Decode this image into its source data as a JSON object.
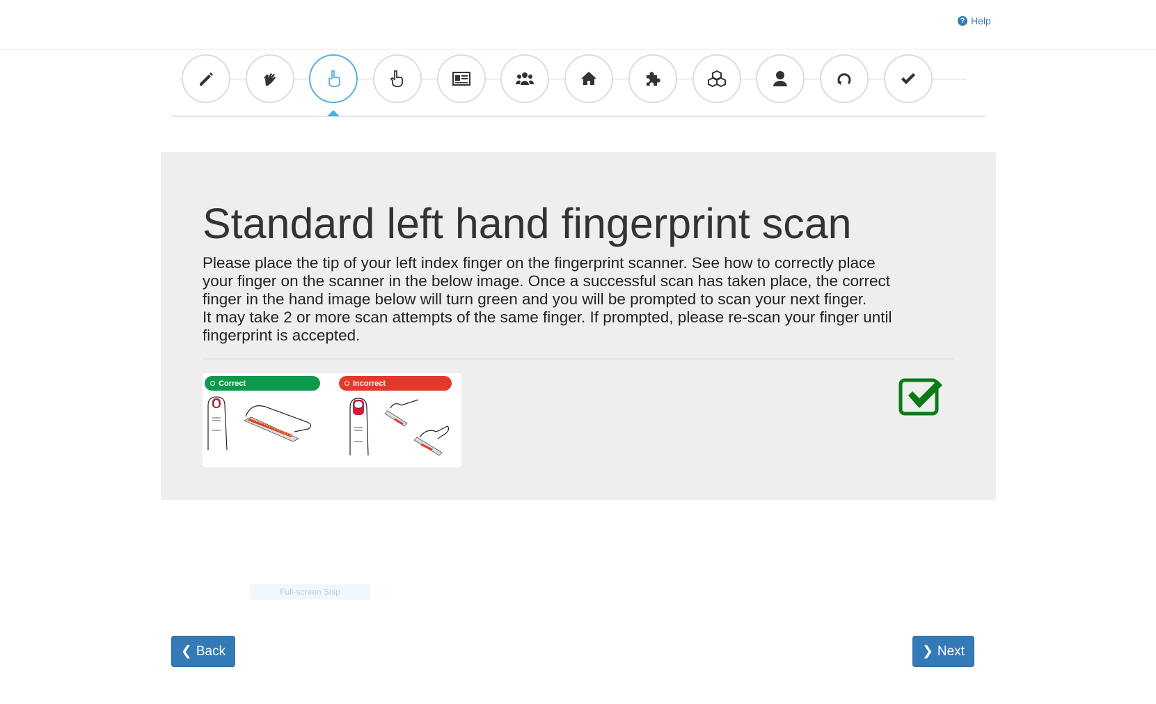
{
  "header": {
    "help_label": "Help",
    "help_icon": "question-circle-icon"
  },
  "stepper": {
    "active_index": 2,
    "steps": [
      {
        "icon": "pencil-icon"
      },
      {
        "icon": "sign-language-icon"
      },
      {
        "icon": "hand-pointer-icon"
      },
      {
        "icon": "hand-pointer-left-icon"
      },
      {
        "icon": "id-card-icon"
      },
      {
        "icon": "users-icon"
      },
      {
        "icon": "home-icon"
      },
      {
        "icon": "puzzle-icon"
      },
      {
        "icon": "cubes-icon"
      },
      {
        "icon": "user-icon"
      },
      {
        "icon": "reset-icon"
      },
      {
        "icon": "check-icon"
      }
    ]
  },
  "main": {
    "title": "Standard left hand fingerprint scan",
    "description_lines": [
      "Please place the tip of your left index finger on the fingerprint scanner. See how to correctly place",
      "your finger on the scanner in the below image. Once a successful scan has taken place, the correct",
      "finger in the hand image below will turn green and you will be prompted to scan your next finger.",
      "It may take 2 or more scan attempts of the same finger. If prompted, please re-scan your finger until",
      "fingerprint is accepted."
    ],
    "guide": {
      "correct_label": "Correct",
      "incorrect_label": "Incorrect"
    },
    "status_icon": "check-square-icon",
    "colors": {
      "correct": "#0e9a4d",
      "incorrect": "#e2392b",
      "accepted": "#0a7a14"
    }
  },
  "overlay": {
    "snip_label": "Full-screen Snip"
  },
  "footer": {
    "back_label": "Back",
    "next_label": "Next"
  },
  "colors": {
    "primary": "#337ab7",
    "active_step": "#4fb3d9",
    "panel_bg": "#eeeeee"
  }
}
